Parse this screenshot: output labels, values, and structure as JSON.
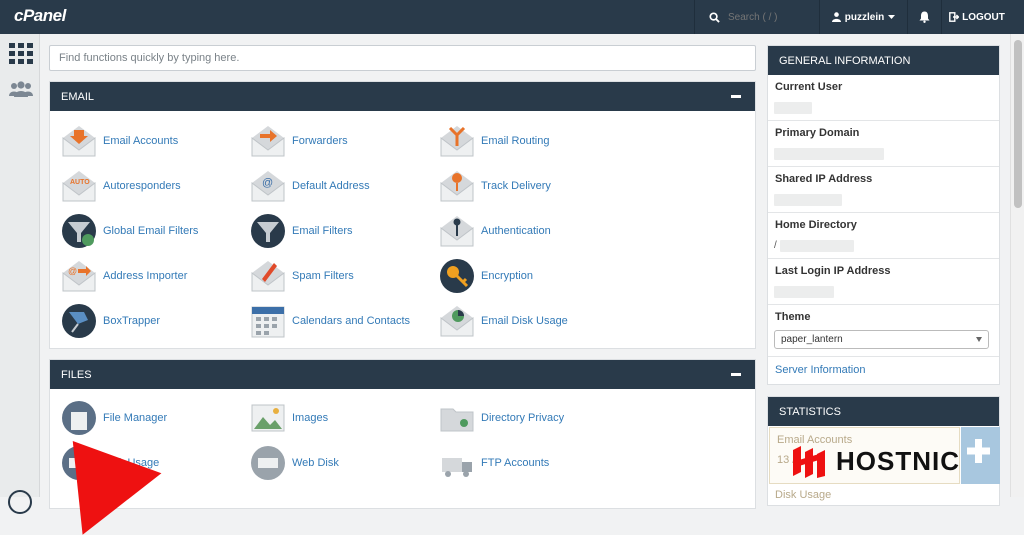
{
  "topbar": {
    "logo": "cPanel",
    "search_placeholder": "Search ( / )",
    "username": "puzzlein",
    "logout": "LOGOUT"
  },
  "quick_search": {
    "placeholder": "Find functions quickly by typing here."
  },
  "email_panel": {
    "title": "EMAIL",
    "items": [
      {
        "label": "Email Accounts",
        "icon": "email-accounts-icon"
      },
      {
        "label": "Forwarders",
        "icon": "forwarders-icon"
      },
      {
        "label": "Email Routing",
        "icon": "email-routing-icon"
      },
      {
        "label": "Autoresponders",
        "icon": "autoresponders-icon"
      },
      {
        "label": "Default Address",
        "icon": "default-address-icon"
      },
      {
        "label": "Track Delivery",
        "icon": "track-delivery-icon"
      },
      {
        "label": "Global Email Filters",
        "icon": "global-email-filters-icon"
      },
      {
        "label": "Email Filters",
        "icon": "email-filters-icon"
      },
      {
        "label": "Authentication",
        "icon": "authentication-icon"
      },
      {
        "label": "Address Importer",
        "icon": "address-importer-icon"
      },
      {
        "label": "Spam Filters",
        "icon": "spam-filters-icon"
      },
      {
        "label": "Encryption",
        "icon": "encryption-icon"
      },
      {
        "label": "BoxTrapper",
        "icon": "boxtrapper-icon"
      },
      {
        "label": "Calendars and Contacts",
        "icon": "calendars-contacts-icon"
      },
      {
        "label": "Email Disk Usage",
        "icon": "email-disk-usage-icon"
      }
    ]
  },
  "files_panel": {
    "title": "FILES",
    "items": [
      {
        "label": "File Manager",
        "icon": "file-manager-icon"
      },
      {
        "label": "Images",
        "icon": "images-icon"
      },
      {
        "label": "Directory Privacy",
        "icon": "directory-privacy-icon"
      },
      {
        "label": "Disk Usage",
        "icon": "disk-usage-icon"
      },
      {
        "label": "Web Disk",
        "icon": "web-disk-icon"
      },
      {
        "label": "FTP Accounts",
        "icon": "ftp-accounts-icon"
      }
    ]
  },
  "general_info": {
    "title": "GENERAL INFORMATION",
    "current_user": "Current User",
    "primary_domain": "Primary Domain",
    "shared_ip": "Shared IP Address",
    "home_dir": "Home Directory",
    "home_dir_prefix": "/",
    "last_login": "Last Login IP Address",
    "theme": "Theme",
    "theme_value": "paper_lantern",
    "server_info": "Server Information"
  },
  "statistics": {
    "title": "STATISTICS",
    "email_accounts": "Email Accounts",
    "email_accounts_value": "13 /",
    "disk_usage": "Disk Usage"
  },
  "watermark": {
    "text": "HOSTNIC"
  },
  "colors": {
    "navbar": "#293a4a",
    "link": "#337ab7",
    "accent_orange": "#e8732a",
    "accent_red": "#e11111"
  }
}
